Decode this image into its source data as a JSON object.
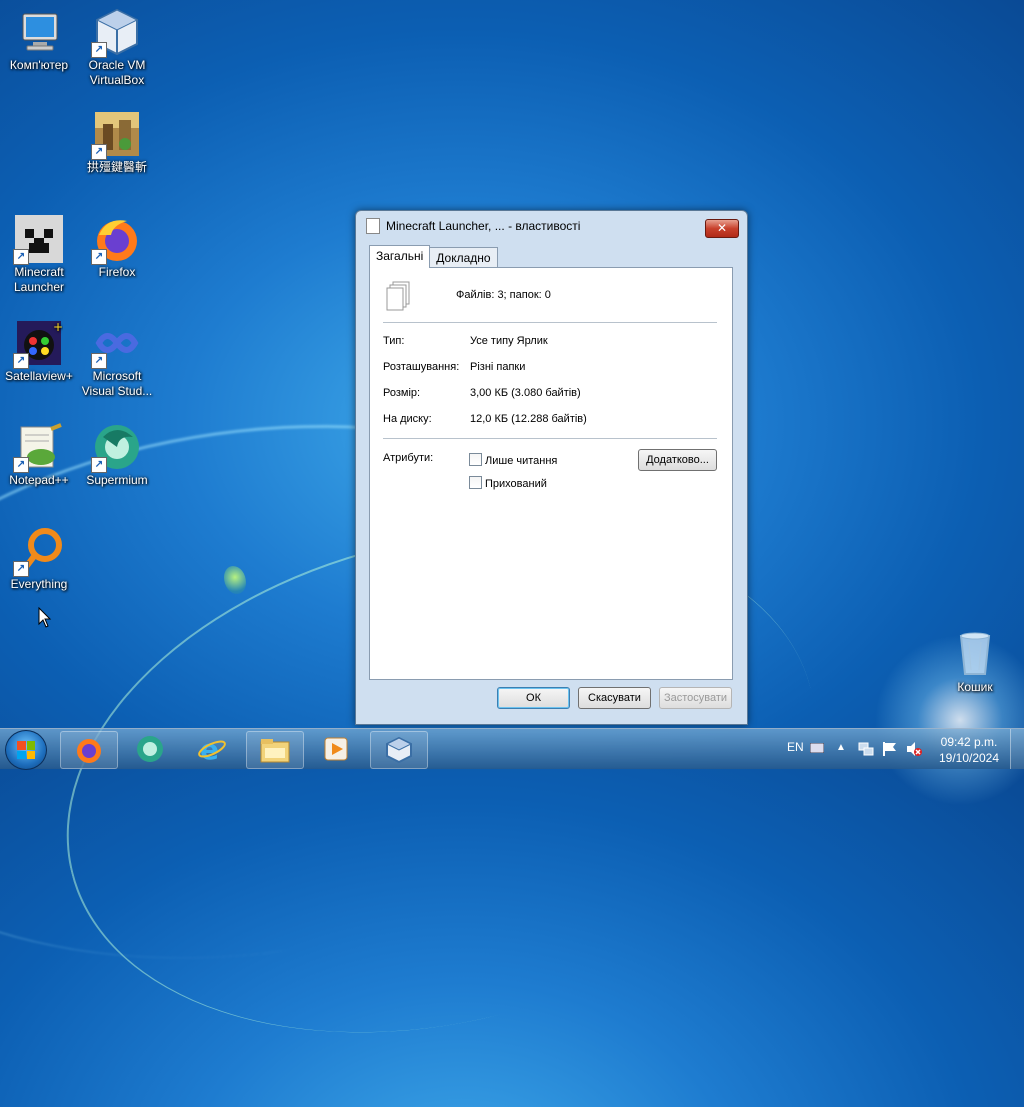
{
  "desktop": {
    "icons": [
      {
        "label": "Комп'ютер",
        "icon": "computer-icon"
      },
      {
        "label": "Oracle VM VirtualBox",
        "icon": "virtualbox-icon"
      },
      {
        "label": "拱殭鍵醫斬",
        "icon": "game-icon"
      },
      {
        "label": "Minecraft Launcher",
        "icon": "minecraft-icon"
      },
      {
        "label": "Firefox",
        "icon": "firefox-icon"
      },
      {
        "label": "Satellaview+",
        "icon": "satellaview-icon"
      },
      {
        "label": "Microsoft Visual Stud...",
        "icon": "visual-studio-icon"
      },
      {
        "label": "Notepad++",
        "icon": "notepadpp-icon"
      },
      {
        "label": "Supermium",
        "icon": "supermium-icon"
      },
      {
        "label": "Everything",
        "icon": "everything-icon"
      },
      {
        "label": "Кошик",
        "icon": "recycle-bin-icon"
      }
    ]
  },
  "dialog": {
    "title": "Minecraft Launcher, ... - властивості",
    "close": "✕",
    "tabs": [
      {
        "label": "Загальні"
      },
      {
        "label": "Докладно"
      }
    ],
    "summary": "Файлів: 3; папок: 0",
    "fields": [
      {
        "label": "Тип:",
        "value": "Усе типу Ярлик"
      },
      {
        "label": "Розташування:",
        "value": "Різні папки"
      },
      {
        "label": "Розмір:",
        "value": "3,00 КБ (3.080 байтів)"
      },
      {
        "label": "На диску:",
        "value": "12,0 КБ (12.288 байтів)"
      }
    ],
    "attributes_label": "Атрибути:",
    "readonly_label": "Лише читання",
    "hidden_label": "Прихований",
    "advanced_label": "Додатково...",
    "ok_label": "ОК",
    "cancel_label": "Скасувати",
    "apply_label": "Застосувати"
  },
  "taskbar": {
    "lang": "EN",
    "time": "09:42 p.m.",
    "date": "19/10/2024"
  }
}
